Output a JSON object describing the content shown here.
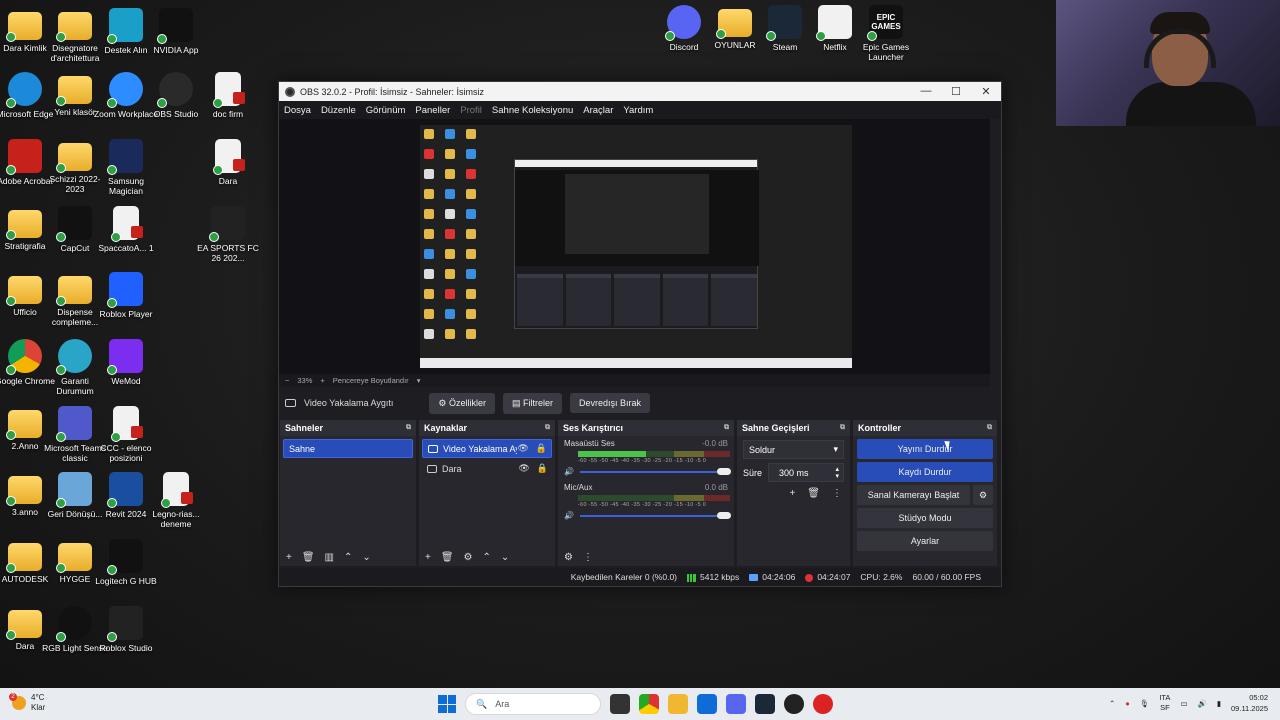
{
  "desktop": {
    "icons": [
      {
        "label": "Dara Kimlik",
        "icon": "folder-icon"
      },
      {
        "label": "Disegnatore d'architettura",
        "icon": "folder-icon"
      },
      {
        "label": "Destek Alın",
        "icon": "help-app-icon"
      },
      {
        "label": "NVIDIA App",
        "icon": "nvidia-icon"
      },
      {
        "label": "Microsoft Edge",
        "icon": "edge-icon"
      },
      {
        "label": "Yeni klasör",
        "icon": "folder-icon"
      },
      {
        "label": "Zoom Workplace",
        "icon": "zoom-icon"
      },
      {
        "label": "OBS Studio",
        "icon": "obs-icon"
      },
      {
        "label": "doc firm",
        "icon": "pdf-icon"
      },
      {
        "label": "Adobe Acrobat",
        "icon": "acrobat-icon"
      },
      {
        "label": "Schizzi 2022-2023",
        "icon": "folder-icon"
      },
      {
        "label": "Samsung Magician",
        "icon": "samsung-magician-icon"
      },
      {
        "label": "Dara",
        "icon": "pdf-icon"
      },
      {
        "label": "Stratigrafia",
        "icon": "folder-icon"
      },
      {
        "label": "CapCut",
        "icon": "capcut-icon"
      },
      {
        "label": "SpaccatoA... 1",
        "icon": "pdf-icon"
      },
      {
        "label": "EA SPORTS FC 26 202...",
        "icon": "ea-sports-icon"
      },
      {
        "label": "Ufficio",
        "icon": "folder-icon"
      },
      {
        "label": "Dispense compleme...",
        "icon": "folder-icon"
      },
      {
        "label": "Roblox Player",
        "icon": "roblox-icon"
      },
      {
        "label": "Google Chrome",
        "icon": "chrome-icon"
      },
      {
        "label": "Garanti Durumum",
        "icon": "garanti-icon"
      },
      {
        "label": "WeMod",
        "icon": "wemod-icon"
      },
      {
        "label": "2.Anno",
        "icon": "folder-icon"
      },
      {
        "label": "Microsoft Teams classic",
        "icon": "teams-icon"
      },
      {
        "label": "CCC - elenco posizioni",
        "icon": "pdf-icon"
      },
      {
        "label": "3.anno",
        "icon": "folder-icon"
      },
      {
        "label": "Geri Dönüşü...",
        "icon": "recycle-bin-icon"
      },
      {
        "label": "Revit 2024",
        "icon": "revit-icon"
      },
      {
        "label": "Legno-rias... deneme",
        "icon": "pdf-icon"
      },
      {
        "label": "AUTODESK",
        "icon": "folder-icon"
      },
      {
        "label": "HYGGE",
        "icon": "folder-icon"
      },
      {
        "label": "Logitech G HUB",
        "icon": "logitech-icon"
      },
      {
        "label": "Dara",
        "icon": "folder-icon"
      },
      {
        "label": "RGB Light Sense",
        "icon": "rgb-icon"
      },
      {
        "label": "Roblox Studio",
        "icon": "roblox-studio-icon"
      },
      {
        "label": "Discord",
        "icon": "discord-icon"
      },
      {
        "label": "OYUNLAR",
        "icon": "folder-icon"
      },
      {
        "label": "Steam",
        "icon": "steam-icon"
      },
      {
        "label": "Netflix",
        "icon": "file-icon"
      },
      {
        "label": "Epic Games Launcher",
        "icon": "epic-games-icon"
      }
    ],
    "epic_logo_text": "EPIC GAMES"
  },
  "obs": {
    "title": "OBS 32.0.2 - Profil: İsimsiz - Sahneler: İsimsiz",
    "menu": [
      "Dosya",
      "Düzenle",
      "Görünüm",
      "Paneller",
      "Profil",
      "Sahne Koleksiyonu",
      "Araçlar",
      "Yardım"
    ],
    "zoom": {
      "minus": "−",
      "value": "33%",
      "plus": "+",
      "fit_label": "Pencereye Boyutlandır"
    },
    "source_bar": {
      "source_name": "Video Yakalama Aygıtı",
      "properties": "Özellikler",
      "filters": "Filtreler",
      "deactivate": "Devredışı Bırak"
    },
    "scenes": {
      "title": "Sahneler",
      "items": [
        "Sahne"
      ]
    },
    "sources": {
      "title": "Kaynaklar",
      "items": [
        "Video Yakalama Aygıtı",
        "Dara"
      ]
    },
    "mixer": {
      "title": "Ses Karıştırıcı",
      "channels": [
        {
          "name": "Masaüstü Ses",
          "db": "-0.0 dB",
          "level": 0.45
        },
        {
          "name": "Mic/Aux",
          "db": "0.0 dB",
          "level": 0.0
        }
      ],
      "scale": "-60 -55 -50 -45 -40 -35 -30 -25 -20 -15 -10 -5 0"
    },
    "transitions": {
      "title": "Sahne Geçişleri",
      "selected": "Soldur",
      "duration_label": "Süre",
      "duration_value": "300 ms"
    },
    "controls": {
      "title": "Kontroller",
      "stop_stream": "Yayını Durdur",
      "stop_record": "Kaydı Durdur",
      "virtual_cam": "Sanal Kamerayı Başlat",
      "studio_mode": "Stüdyo Modu",
      "settings": "Ayarlar"
    },
    "status": {
      "dropped": "Kaybedilen Kareler 0 (%0.0)",
      "bitrate": "5412 kbps",
      "stream_time": "04:24:06",
      "rec_time": "04:24:07",
      "cpu": "CPU: 2.6%",
      "fps": "60.00 / 60.00 FPS"
    }
  },
  "taskbar": {
    "weather_temp": "4°C",
    "weather_desc": "Klar",
    "weather_alert": "2",
    "search_placeholder": "Ara",
    "lang_top": "ITA",
    "lang_bottom": "SF",
    "time": "05:02",
    "date": "09.11.2025"
  }
}
